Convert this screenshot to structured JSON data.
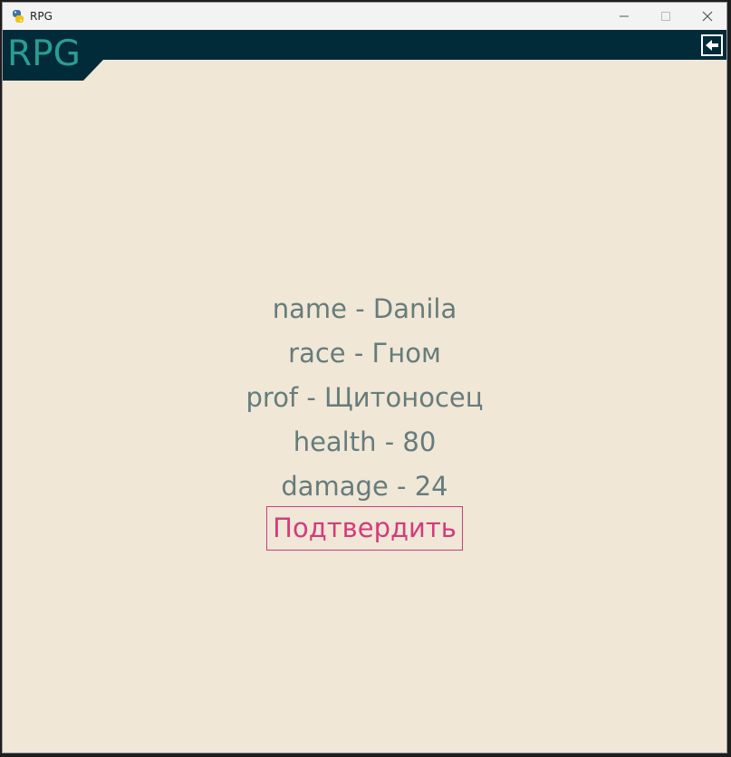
{
  "window": {
    "title": "RPG"
  },
  "header": {
    "title": "RPG"
  },
  "character": {
    "lines": [
      "name - Danila",
      "race - Гном",
      "prof - Щитоносец",
      "health - 80",
      "damage - 24"
    ]
  },
  "actions": {
    "confirm_label": "Подтвердить"
  },
  "colors": {
    "background": "#f0e7d6",
    "header_bar": "#022b3a",
    "title_text": "#2a9d8f",
    "stat_text": "#667c7c",
    "confirm_accent": "#d23c7c"
  },
  "icons": {
    "app": "python-icon",
    "back": "arrow-left-icon",
    "minimize": "minimize-icon",
    "maximize": "maximize-icon",
    "close": "close-icon"
  }
}
